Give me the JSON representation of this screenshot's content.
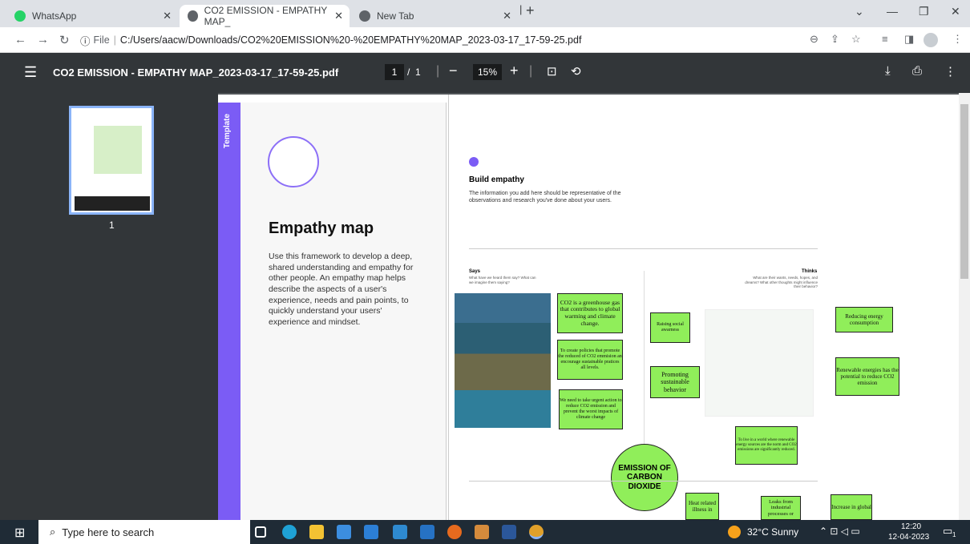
{
  "tabs": [
    {
      "label": "WhatsApp"
    },
    {
      "label": "CO2 EMISSION - EMPATHY MAP_"
    },
    {
      "label": "New Tab"
    }
  ],
  "address": {
    "info": "File",
    "url": "C:/Users/aacw/Downloads/CO2%20EMISSION%20-%20EMPATHY%20MAP_2023-03-17_17-59-25.pdf"
  },
  "pdf": {
    "filename": "CO2 EMISSION - EMPATHY MAP_2023-03-17_17-59-25.pdf",
    "page_current": "1",
    "page_sep": "/",
    "page_total": "1",
    "zoom": "15%"
  },
  "thumb": {
    "label": "1"
  },
  "template": {
    "side_label": "Template",
    "title": "Empathy map",
    "body": "Use this framework to develop a deep, shared understanding and empathy for other people. An empathy map helps describe the aspects of a user's experience, needs and pain points, to quickly understand your users' experience and mindset."
  },
  "canvas": {
    "section_title": "Build empathy",
    "section_desc": "The information you add here should be representative of the observations and research you've done about your users.",
    "says_title": "Says",
    "says_sub": "What have we heard them say? What can we imagine them saying?",
    "thinks_title": "Thinks",
    "thinks_sub": "What are their wants, needs, hopes, and dreams? What other thoughts might influence their behavior?",
    "center": "EMISSION OF CARBON DIOXIDE"
  },
  "notes": {
    "n1": "CO2 is a greenhouse gas that contributes to global warming and climate change.",
    "n2": "To create policies that promote the reduced of CO2 emmision an encourage sustainable pratices all levels.",
    "n3": "We need to take urgent action to reduce CO2 emission and prevent the worst impacts of climate change",
    "n4": "Raising social awarness",
    "n5": "Promoting sustainable behavior",
    "n6": "Reducing energy consumption",
    "n7": "Renewable energies has the potential to reduce CO2 emission",
    "n8": "To live in a world where renewable energy sources are the norm and CO2 emissions are significantly reduced.",
    "n9": "Heat related illness in",
    "n10": "Leaks from industrial processes or",
    "n11": "Increase in global"
  },
  "taskbar": {
    "search_placeholder": "Type here to search",
    "weather": "32°C  Sunny",
    "time": "12:20",
    "date": "12-04-2023",
    "notif_count": "1"
  },
  "icons": [
    "whatsapp-icon",
    "chrome-icon",
    "menu-icon",
    "download-icon",
    "print-icon",
    "more-icon",
    "zoom-in-icon",
    "zoom-out-icon",
    "fit-page-icon",
    "rotate-icon",
    "windows-icon",
    "search-icon",
    "edge-icon",
    "file-explorer-icon",
    "store-icon",
    "mail-icon",
    "word-icon"
  ]
}
